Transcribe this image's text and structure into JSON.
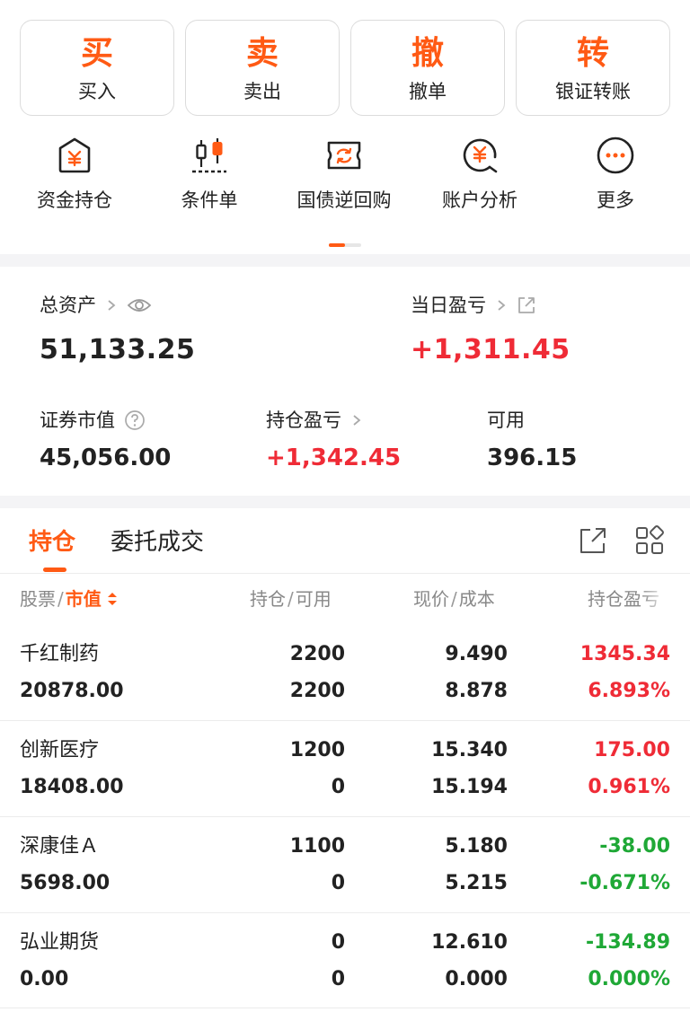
{
  "trade_buttons": [
    {
      "big": "买",
      "small": "买入"
    },
    {
      "big": "卖",
      "small": "卖出"
    },
    {
      "big": "撤",
      "small": "撤单"
    },
    {
      "big": "转",
      "small": "银证转账"
    }
  ],
  "quick_menu": [
    {
      "label": "资金持仓",
      "icon": "fund-position-icon"
    },
    {
      "label": "条件单",
      "icon": "condition-order-icon"
    },
    {
      "label": "国债逆回购",
      "icon": "reverse-repo-icon"
    },
    {
      "label": "账户分析",
      "icon": "account-analysis-icon"
    },
    {
      "label": "更多",
      "icon": "more-icon"
    }
  ],
  "assets": {
    "total_label": "总资产",
    "total_value": "51,133.25",
    "daily_pl_label": "当日盈亏",
    "daily_pl_value": "+1,311.45",
    "market_value_label": "证券市值",
    "market_value": "45,056.00",
    "position_pl_label": "持仓盈亏",
    "position_pl_value": "+1,342.45",
    "available_label": "可用",
    "available_value": "396.15"
  },
  "tabs": {
    "holdings": "持仓",
    "orders": "委托成交"
  },
  "columns": {
    "stock": "股票",
    "market_value": "市值",
    "position": "持仓",
    "available": "可用",
    "price": "现价",
    "cost": "成本",
    "pl": "持仓盈亏"
  },
  "colors": {
    "accent": "#ff5a14",
    "profit": "#ef2b36",
    "loss": "#1fa836"
  },
  "holdings": [
    {
      "name": "千红制药",
      "market_value": "20878.00",
      "position": "2200",
      "available": "2200",
      "price": "9.490",
      "cost": "8.878",
      "pl": "1345.34",
      "pl_pct": "6.893%",
      "trend": "up"
    },
    {
      "name": "创新医疗",
      "market_value": "18408.00",
      "position": "1200",
      "available": "0",
      "price": "15.340",
      "cost": "15.194",
      "pl": "175.00",
      "pl_pct": "0.961%",
      "trend": "up"
    },
    {
      "name": "深康佳Ａ",
      "market_value": "5698.00",
      "position": "1100",
      "available": "0",
      "price": "5.180",
      "cost": "5.215",
      "pl": "-38.00",
      "pl_pct": "-0.671%",
      "trend": "down"
    },
    {
      "name": "弘业期货",
      "market_value": "0.00",
      "position": "0",
      "available": "0",
      "price": "12.610",
      "cost": "0.000",
      "pl": "-134.89",
      "pl_pct": "0.000%",
      "trend": "down"
    }
  ]
}
